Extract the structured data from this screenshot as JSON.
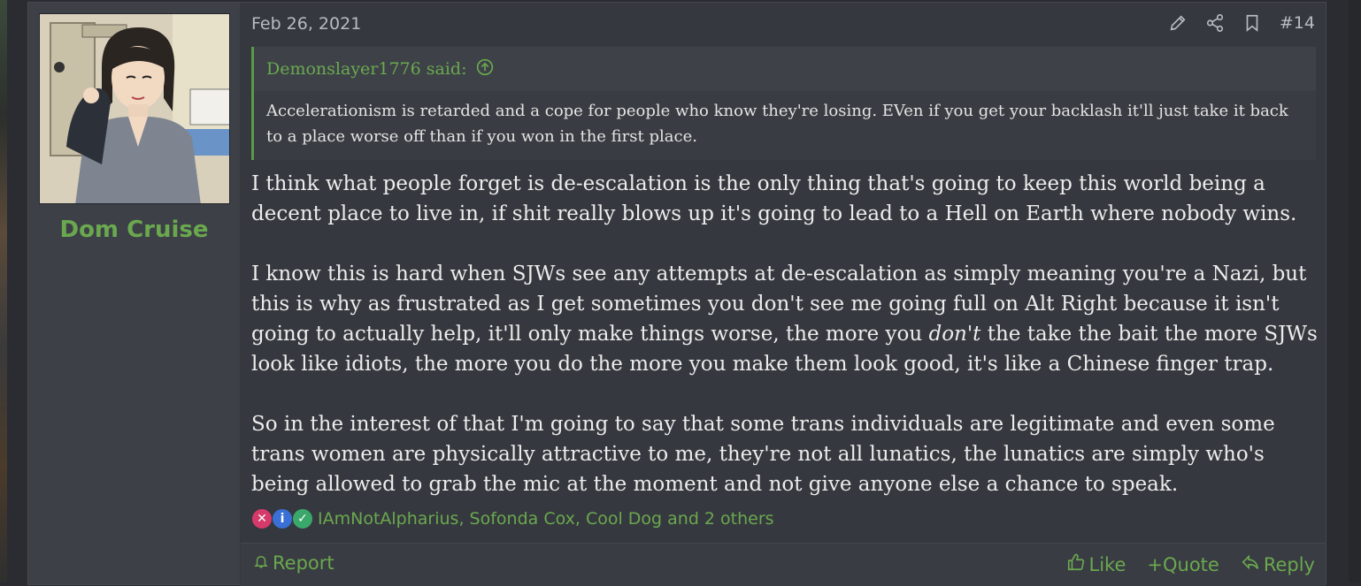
{
  "post": {
    "date": "Feb 26, 2021",
    "number": "#14",
    "author": "Dom Cruise",
    "quote": {
      "author_said": "Demonslayer1776 said:",
      "text": "Accelerationism is retarded and a cope for people who know they're losing. EVen if you get your backlash it'll just take it back to a place worse off than if you won in the first place."
    },
    "paragraphs": {
      "p1": "I think what people forget is de-escalation is the only thing that's going to keep this world being a decent place to live in, if shit really blows up it's going to lead to a Hell on Earth where nobody wins.",
      "p2_before": "I know this is hard when SJWs see any attempts at de-escalation as simply meaning you're a Nazi, but this is why as frustrated as I get sometimes you don't see me going full on Alt Right because it isn't going to actually help, it'll only make things worse, the more you ",
      "p2_em": "don't",
      "p2_after": " the take the bait the more SJWs look like idiots, the more you do the more you make them look good, it's like a Chinese finger trap.",
      "p3": "So in the interest of that I'm going to say that some trans individuals are legitimate and even some trans women are physically attractive to me, they're not all lunatics, the lunatics are simply who's being allowed to grab the mic at the moment and not give anyone else a chance to speak."
    },
    "reactions": {
      "names": "IAmNotAlpharius, Sofonda Cox, Cool Dog and 2 others",
      "icons": [
        {
          "name": "x-reaction-icon",
          "glyph": "✕",
          "color": "#d63a6a"
        },
        {
          "name": "info-reaction-icon",
          "glyph": "i",
          "color": "#3a6fd6"
        },
        {
          "name": "check-reaction-icon",
          "glyph": "✓",
          "color": "#3aa86a"
        }
      ]
    },
    "footer": {
      "report": "Report",
      "like": "Like",
      "quote": "+Quote",
      "reply": "Reply"
    }
  },
  "colors": {
    "accent": "#6aa84f",
    "background": "#35383e"
  }
}
